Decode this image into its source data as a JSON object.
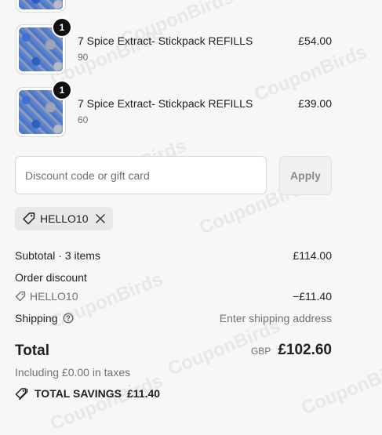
{
  "items": [
    {
      "quantity": "1",
      "title": "7 Spice Extract- Stickpack REFILLS",
      "subtitle": "90",
      "price": "£54.00"
    },
    {
      "quantity": "1",
      "title": "7 Spice Extract- Stickpack REFILLS",
      "subtitle": "60",
      "price": "£39.00"
    }
  ],
  "discount": {
    "placeholder": "Discount code or gift card",
    "apply_label": "Apply",
    "applied_code": "HELLO10"
  },
  "summary": {
    "subtotal_label": "Subtotal · 3 items",
    "subtotal_value": "£114.00",
    "order_discount_label": "Order discount",
    "order_discount_code": "HELLO10",
    "order_discount_value": "−£11.40",
    "shipping_label": "Shipping",
    "shipping_value": "Enter shipping address",
    "total_label": "Total",
    "total_currency": "GBP",
    "total_value": "£102.60",
    "taxes_note": "Including £0.00 in taxes",
    "savings_label": "TOTAL SAVINGS",
    "savings_value": "£11.40"
  },
  "watermark": "CouponBirds",
  "icons": {
    "tag": "tag-icon",
    "close": "close-icon",
    "help": "help-circle-icon",
    "savings": "double-tag-icon"
  }
}
